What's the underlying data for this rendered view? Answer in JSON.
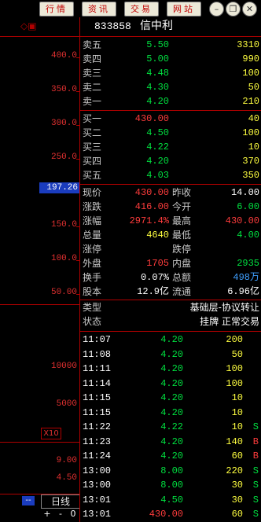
{
  "toolbar": {
    "buttons": [
      "行情",
      "资讯",
      "交易",
      "网站"
    ],
    "window_controls": [
      "minimize-icon",
      "restore-icon",
      "close-icon"
    ]
  },
  "chart": {
    "y_labels": [
      "400.0",
      "350.0",
      "300.0",
      "250.0",
      "200.0",
      "150.0",
      "100.0",
      "50.00"
    ],
    "price_tag": "197.26",
    "vol_labels": [
      "10000",
      "5000"
    ],
    "vol_multiplier": "X10",
    "sub_labels": [
      "9.00",
      "4.50"
    ],
    "period": "日线",
    "bottom_controls": [
      "--",
      "+",
      "-",
      "0"
    ]
  },
  "quote": {
    "code": "833858",
    "name": "信中利",
    "asks": [
      {
        "label": "卖五",
        "price": "5.50",
        "vol": "3310"
      },
      {
        "label": "卖四",
        "price": "5.00",
        "vol": "990"
      },
      {
        "label": "卖三",
        "price": "4.48",
        "vol": "100"
      },
      {
        "label": "卖二",
        "price": "4.30",
        "vol": "50"
      },
      {
        "label": "卖一",
        "price": "4.20",
        "vol": "210"
      }
    ],
    "bids": [
      {
        "label": "买一",
        "price": "430.00",
        "vol": "40"
      },
      {
        "label": "买二",
        "price": "4.50",
        "vol": "100"
      },
      {
        "label": "买三",
        "price": "4.22",
        "vol": "10"
      },
      {
        "label": "买四",
        "price": "4.20",
        "vol": "370"
      },
      {
        "label": "买五",
        "price": "4.03",
        "vol": "350"
      }
    ],
    "stats": [
      {
        "l1": "现价",
        "v1": "430.00",
        "l2": "昨收",
        "v2": "14.00"
      },
      {
        "l1": "涨跌",
        "v1": "416.00",
        "l2": "今开",
        "v2": "6.00"
      },
      {
        "l1": "涨幅",
        "v1": "2971.4%",
        "l2": "最高",
        "v2": "430.00"
      },
      {
        "l1": "总量",
        "v1": "4640",
        "l2": "最低",
        "v2": "4.00"
      },
      {
        "l1": "涨停",
        "v1": "",
        "l2": "跌停",
        "v2": ""
      },
      {
        "l1": "外盘",
        "v1": "1705",
        "l2": "内盘",
        "v2": "2935"
      },
      {
        "l1": "换手",
        "v1": "0.07%",
        "l2": "总额",
        "v2": "498万"
      },
      {
        "l1": "股本",
        "v1": "12.9亿",
        "l2": "流通",
        "v2": "6.96亿"
      }
    ],
    "type_label": "类型",
    "type_value": "基础层-协议转让",
    "status_label": "状态",
    "status_value": "挂牌 正常交易"
  },
  "trades": [
    {
      "time": "11:07",
      "price": "4.20",
      "vol": "200",
      "side": ""
    },
    {
      "time": "11:08",
      "price": "4.20",
      "vol": "50",
      "side": ""
    },
    {
      "time": "11:11",
      "price": "4.20",
      "vol": "100",
      "side": ""
    },
    {
      "time": "11:14",
      "price": "4.20",
      "vol": "100",
      "side": ""
    },
    {
      "time": "11:15",
      "price": "4.20",
      "vol": "10",
      "side": ""
    },
    {
      "time": "11:15",
      "price": "4.20",
      "vol": "10",
      "side": ""
    },
    {
      "time": "11:22",
      "price": "4.22",
      "vol": "10",
      "side": "S"
    },
    {
      "time": "11:23",
      "price": "4.20",
      "vol": "140",
      "side": "B"
    },
    {
      "time": "11:24",
      "price": "4.20",
      "vol": "60",
      "side": "B"
    },
    {
      "time": "13:00",
      "price": "8.00",
      "vol": "220",
      "side": "S"
    },
    {
      "time": "13:00",
      "price": "8.00",
      "vol": "30",
      "side": "S"
    },
    {
      "time": "13:01",
      "price": "4.50",
      "vol": "30",
      "side": "S"
    },
    {
      "time": "13:01",
      "price": "430.00",
      "vol": "60",
      "side": "S"
    }
  ]
}
